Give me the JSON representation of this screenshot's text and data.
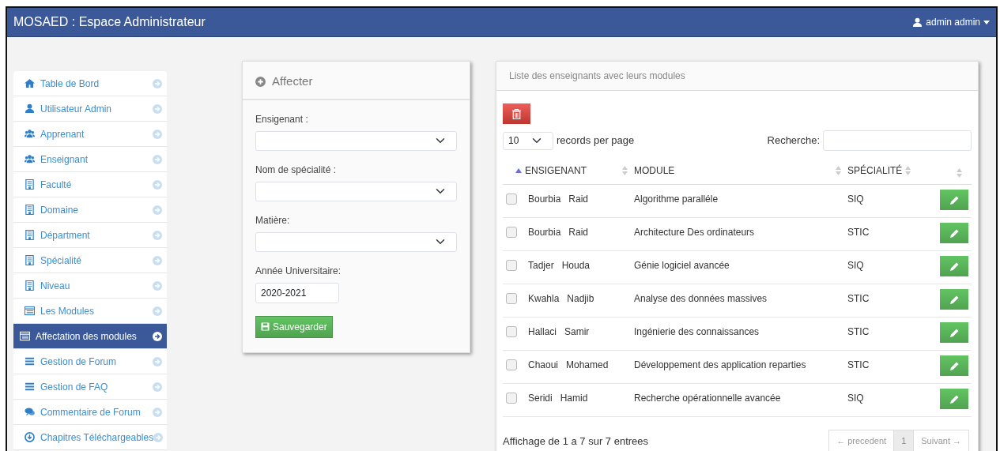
{
  "navbar": {
    "brand": "MOSAED : Espace Administrateur",
    "user": "admin admin"
  },
  "sidebar": {
    "items": [
      {
        "label": "Table de Bord",
        "kind": "home",
        "selected": false
      },
      {
        "label": "Utilisateur Admin",
        "kind": "user",
        "selected": false
      },
      {
        "label": "Apprenant",
        "kind": "users",
        "selected": false
      },
      {
        "label": "Enseignant",
        "kind": "users",
        "selected": false
      },
      {
        "label": "Faculté",
        "kind": "building",
        "selected": false
      },
      {
        "label": "Domaine",
        "kind": "building",
        "selected": false
      },
      {
        "label": "Départment",
        "kind": "building",
        "selected": false
      },
      {
        "label": "Spécialité",
        "kind": "building",
        "selected": false
      },
      {
        "label": "Niveau",
        "kind": "building",
        "selected": false
      },
      {
        "label": "Les Modules",
        "kind": "table",
        "selected": false
      },
      {
        "label": "Affectation des modules",
        "kind": "table",
        "selected": true
      },
      {
        "label": "Gestion de Forum",
        "kind": "bars",
        "selected": false
      },
      {
        "label": "Gestion de FAQ",
        "kind": "bars",
        "selected": false
      },
      {
        "label": "Commentaire de Forum",
        "kind": "comments",
        "selected": false
      },
      {
        "label": "Chapitres Téléchargeables",
        "kind": "download",
        "selected": false
      }
    ]
  },
  "form": {
    "title": "Affecter",
    "fields": [
      {
        "label": "Ensigenant :",
        "kind": "select"
      },
      {
        "label": "Nom de spécialité :",
        "kind": "select"
      },
      {
        "label": "Matière:",
        "kind": "select"
      },
      {
        "label": "Année Universitaire:",
        "kind": "text",
        "value": "2020-2021"
      }
    ],
    "submit": "Sauvegarder"
  },
  "table_panel": {
    "title": "Liste des enseignants avec leurs modules",
    "page_size": "10",
    "page_size_label": "records per page",
    "search_label": "Recherche:",
    "columns": [
      "ENSIGENANT",
      "MODULE",
      "SPÉCIALITÉ"
    ],
    "rows": [
      {
        "last": "Bourbia",
        "first": "Raid",
        "module": "Algorithme paralléle",
        "specialty": "SIQ",
        "checked": false
      },
      {
        "last": "Bourbia",
        "first": "Raid",
        "module": "Architecture Des ordinateurs",
        "specialty": "STIC",
        "checked": false
      },
      {
        "last": "Tadjer",
        "first": "Houda",
        "module": "Génie logiciel avancée",
        "specialty": "SIQ",
        "checked": false
      },
      {
        "last": "Kwahla",
        "first": "Nadjib",
        "module": "Analyse des données massives",
        "specialty": "STIC",
        "checked": false
      },
      {
        "last": "Hallaci",
        "first": "Samir",
        "module": "Ingénierie des connaissances",
        "specialty": "STIC",
        "checked": false
      },
      {
        "last": "Chaoui",
        "first": "Mohamed",
        "module": "Développement des application reparties",
        "specialty": "STIC",
        "checked": false
      },
      {
        "last": "Seridi",
        "first": "Hamid",
        "module": "Recherche opérationnelle avancée",
        "specialty": "SIQ",
        "checked": false
      }
    ],
    "info": "Affichage de 1 a 7 sur 7 entrees",
    "pagination": [
      {
        "label": "← precedent",
        "selected": false
      },
      {
        "label": "1",
        "selected": true
      },
      {
        "label": "Suivant →",
        "selected": false
      }
    ]
  }
}
